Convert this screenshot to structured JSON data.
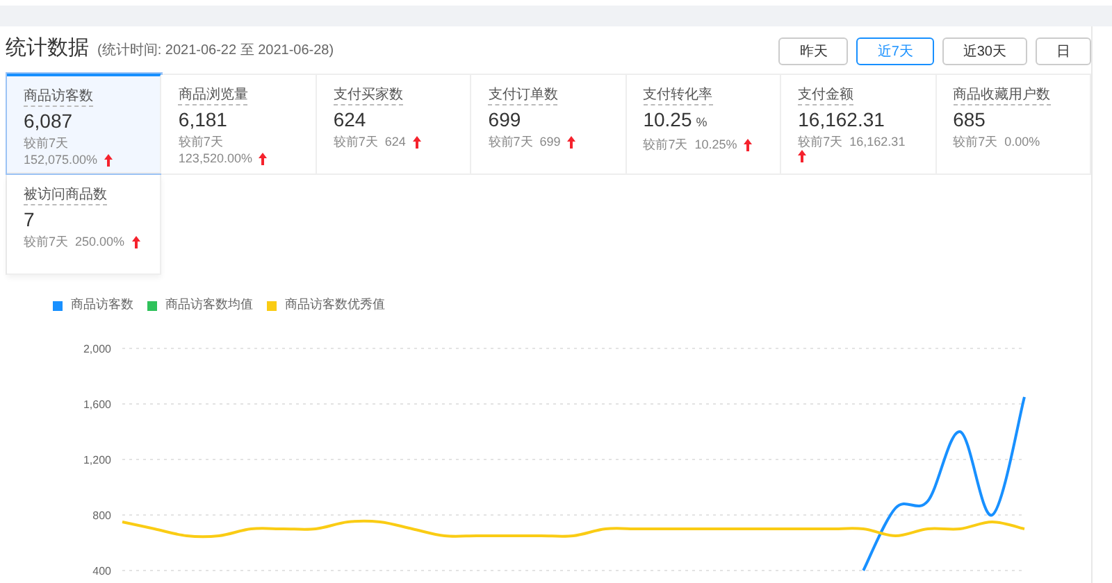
{
  "header": {
    "title": "统计数据",
    "subtitle": "(统计时间: 2021-06-22 至 2021-06-28)"
  },
  "range_buttons": [
    {
      "label": "昨天",
      "selected": false
    },
    {
      "label": "近7天",
      "selected": true
    },
    {
      "label": "近30天",
      "selected": false
    },
    {
      "label": "日",
      "selected": false
    }
  ],
  "stats": [
    {
      "label": "商品访客数",
      "value": "6,087",
      "compare_label": "较前7天",
      "compare_value": "152,075.00%",
      "up_arrow": true,
      "selected": true
    },
    {
      "label": "商品浏览量",
      "value": "6,181",
      "compare_label": "较前7天",
      "compare_value": "123,520.00%",
      "up_arrow": true,
      "selected": false
    },
    {
      "label": "支付买家数",
      "value": "624",
      "compare_label": "较前7天",
      "compare_value": "624",
      "up_arrow": true,
      "selected": false
    },
    {
      "label": "支付订单数",
      "value": "699",
      "compare_label": "较前7天",
      "compare_value": "699",
      "up_arrow": true,
      "selected": false
    },
    {
      "label": "支付转化率",
      "value": "10.25",
      "unit": "%",
      "compare_label": "较前7天",
      "compare_value": "10.25%",
      "up_arrow": true,
      "selected": false
    },
    {
      "label": "支付金额",
      "value": "16,162.31",
      "compare_label": "较前7天",
      "compare_value": "16,162.31",
      "up_arrow": true,
      "selected": false
    },
    {
      "label": "商品收藏用户数",
      "value": "685",
      "compare_label": "较前7天",
      "compare_value": "0.00%",
      "up_arrow": false,
      "selected": false
    },
    {
      "label": "被访问商品数",
      "value": "7",
      "compare_label": "较前7天",
      "compare_value": "250.00%",
      "up_arrow": true,
      "selected": false
    }
  ],
  "chart_data": {
    "type": "line",
    "grid": true,
    "ylim": [
      400,
      2000
    ],
    "yticks": [
      {
        "value": 400,
        "label": "400"
      },
      {
        "value": 800,
        "label": "800"
      },
      {
        "value": 1200,
        "label": "1,200"
      },
      {
        "value": 1600,
        "label": "1,600"
      },
      {
        "value": 2000,
        "label": "2,000"
      }
    ],
    "series": [
      {
        "name": "商品访客数",
        "color": "#1890ff",
        "values": [
          null,
          null,
          null,
          null,
          null,
          null,
          null,
          null,
          null,
          null,
          null,
          null,
          null,
          null,
          null,
          null,
          null,
          null,
          null,
          null,
          null,
          null,
          null,
          400,
          850,
          900,
          1400,
          800,
          1650
        ]
      },
      {
        "name": "商品访客数均值",
        "color": "#2fc25b",
        "values": [
          null,
          null,
          null,
          null,
          null,
          null,
          null,
          null,
          null,
          null,
          null,
          null,
          null,
          null,
          null,
          null,
          null,
          null,
          null,
          null,
          null,
          null,
          null,
          null,
          null,
          null,
          null,
          null,
          null
        ]
      },
      {
        "name": "商品访客数优秀值",
        "color": "#facc14",
        "values": [
          750,
          700,
          650,
          650,
          700,
          700,
          700,
          750,
          750,
          700,
          650,
          650,
          650,
          650,
          650,
          700,
          700,
          700,
          700,
          700,
          700,
          700,
          700,
          700,
          650,
          700,
          700,
          750,
          700
        ]
      }
    ]
  }
}
